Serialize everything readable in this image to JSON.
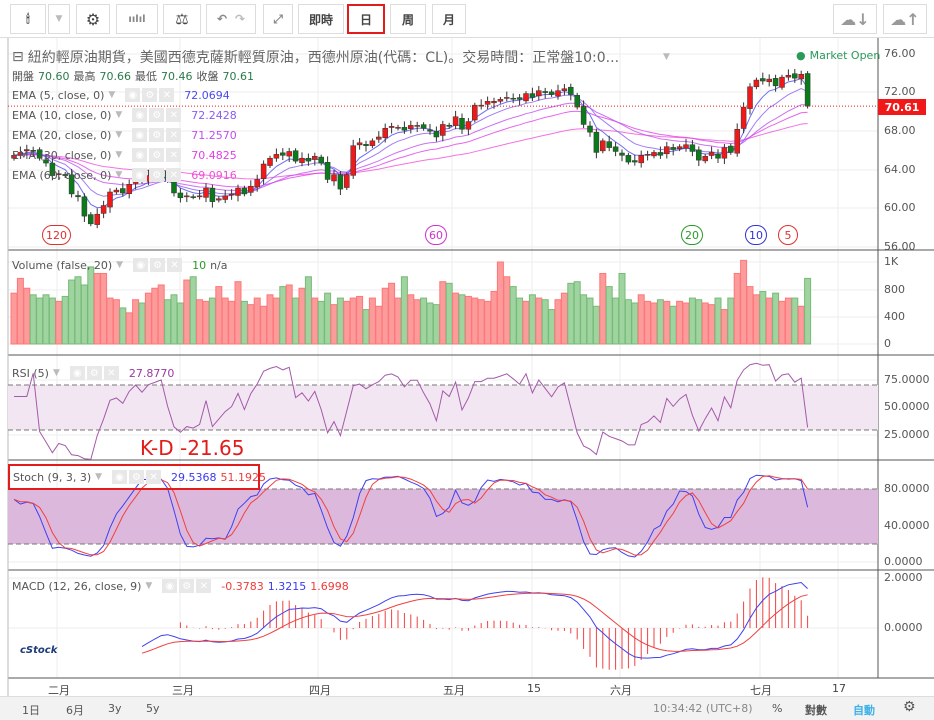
{
  "toolbar": {
    "realtime": "即時",
    "day": "日",
    "week": "周",
    "month": "月",
    "selected": "日"
  },
  "header": {
    "title": "紐約輕原油期貨，美國西德克薩斯輕質原油，西德州原油(代碼：CL)。交易時間：正常盤10:0...",
    "market_status": "Market Open",
    "ohlc": {
      "open_label": "開盤",
      "open": "70.60",
      "high_label": "最高",
      "high": "70.66",
      "low_label": "最低",
      "low": "70.46",
      "close_label": "收盤",
      "close": "70.61"
    }
  },
  "ema": [
    {
      "label": "EMA (5, close, 0)",
      "value": "72.0694",
      "color": "#4a4af0",
      "period": 5
    },
    {
      "label": "EMA (10, close, 0)",
      "value": "72.2428",
      "color": "#8a5cf0",
      "period": 10
    },
    {
      "label": "EMA (20, close, 0)",
      "value": "71.2570",
      "color": "#c04ef0",
      "period": 20
    },
    {
      "label": "EMA (30, close, 0)",
      "value": "70.4825",
      "color": "#e040e8",
      "period": 30
    },
    {
      "label": "EMA (60, close, 0)",
      "value": "69.0916",
      "color": "#f050d8",
      "period": 60
    }
  ],
  "ma_markers": [
    {
      "label": "120",
      "color": "#e03030"
    },
    {
      "label": "60",
      "color": "#d030d0"
    },
    {
      "label": "20",
      "color": "#2a9a2a"
    },
    {
      "label": "10",
      "color": "#3030e0"
    },
    {
      "label": "5",
      "color": "#e03030"
    }
  ],
  "price_axis": [
    "76.00",
    "72.00",
    "68.00",
    "64.00",
    "60.00",
    "56.00"
  ],
  "last_price": "70.61",
  "volume": {
    "label": "Volume (false, 20)",
    "value": "10",
    "na": "n/a",
    "axis": [
      "1K",
      "800",
      "400",
      "0"
    ],
    "values": [
      620,
      800,
      680,
      600,
      560,
      600,
      560,
      520,
      580,
      780,
      820,
      720,
      940,
      860,
      860,
      560,
      540,
      440,
      380,
      540,
      500,
      620,
      680,
      720,
      540,
      600,
      500,
      780,
      820,
      540,
      520,
      560,
      700,
      560,
      520,
      760,
      520,
      480,
      560,
      460,
      600,
      560,
      700,
      720,
      560,
      680,
      820,
      560,
      520,
      620,
      480,
      560,
      520,
      560,
      580,
      420,
      560,
      460,
      680,
      740,
      560,
      820,
      600,
      540,
      560,
      500,
      480,
      760,
      740,
      620,
      600,
      580,
      560,
      540,
      520,
      640,
      1000,
      820,
      700,
      560,
      520,
      600,
      560,
      540,
      420,
      540,
      620,
      740,
      760,
      600,
      560,
      460,
      860,
      700,
      560,
      860,
      540,
      500,
      600,
      520,
      500,
      540,
      520,
      460,
      520,
      500,
      560,
      540,
      500,
      480,
      560,
      420,
      560,
      860,
      1020,
      700,
      600,
      640,
      560,
      620,
      520,
      560,
      560,
      460,
      800
    ]
  },
  "rsi": {
    "label": "RSI (5)",
    "value": "27.8770",
    "axis": [
      "75.0000",
      "50.0000",
      "25.0000"
    ]
  },
  "stoch": {
    "label": "Stoch (9, 3, 3)",
    "k": "29.5368",
    "d": "51.1925",
    "axis": [
      "80.0000",
      "40.0000",
      "0.0000"
    ]
  },
  "kd_annotation": "K-D  -21.65",
  "macd": {
    "label": "MACD (12, 26, close, 9)",
    "hist": "-0.3783",
    "macd": "1.3215",
    "signal": "1.6998",
    "axis": [
      "2.0000",
      "0.0000"
    ]
  },
  "xaxis": [
    "二月",
    "三月",
    "四月",
    "五月",
    "15",
    "六月",
    "七月",
    "17"
  ],
  "bottom": {
    "ranges": [
      "1日",
      "6月",
      "3y",
      "5y"
    ],
    "time": "10:34:42 (UTC+8)",
    "percent": "%",
    "log": "對數",
    "auto": "自動"
  },
  "chart_data": {
    "type": "candlestick",
    "closes": [
      65.5,
      65.8,
      66.1,
      66.0,
      65.2,
      64.7,
      63.4,
      63.6,
      63.4,
      61.5,
      61.2,
      59.2,
      58.4,
      59.4,
      60.3,
      61.7,
      61.9,
      61.6,
      62.5,
      63.1,
      62.8,
      63.4,
      63.6,
      63.8,
      62.9,
      61.6,
      61.1,
      61.3,
      61.2,
      61.3,
      62.1,
      60.7,
      61.0,
      61.3,
      61.5,
      62.1,
      61.5,
      62.3,
      63.0,
      64.6,
      65.2,
      65.6,
      65.5,
      65.9,
      64.9,
      65.2,
      64.9,
      65.4,
      64.7,
      63.0,
      63.5,
      62.0,
      63.5,
      66.5,
      66.8,
      66.5,
      67.0,
      67.4,
      68.3,
      68.5,
      68.4,
      68.1,
      68.6,
      68.6,
      68.3,
      68.0,
      67.4,
      68.7,
      68.5,
      69.5,
      68.2,
      69.0,
      70.7,
      70.7,
      71.1,
      71.1,
      71.3,
      71.5,
      71.4,
      71.3,
      71.9,
      71.5,
      72.2,
      72.0,
      71.8,
      72.2,
      72.4,
      71.8,
      70.5,
      68.7,
      67.9,
      65.8,
      67.0,
      66.3,
      65.9,
      65.5,
      64.8,
      64.8,
      65.5,
      65.6,
      65.8,
      65.5,
      66.4,
      66.1,
      66.4,
      66.6,
      65.9,
      65.0,
      65.4,
      65.8,
      65.2,
      66.3,
      65.8,
      68.2,
      70.5,
      72.6,
      73.3,
      73.2,
      73.4,
      72.7,
      73.6,
      73.8,
      73.5,
      73.9,
      70.6
    ],
    "ylim": [
      56,
      76
    ]
  }
}
